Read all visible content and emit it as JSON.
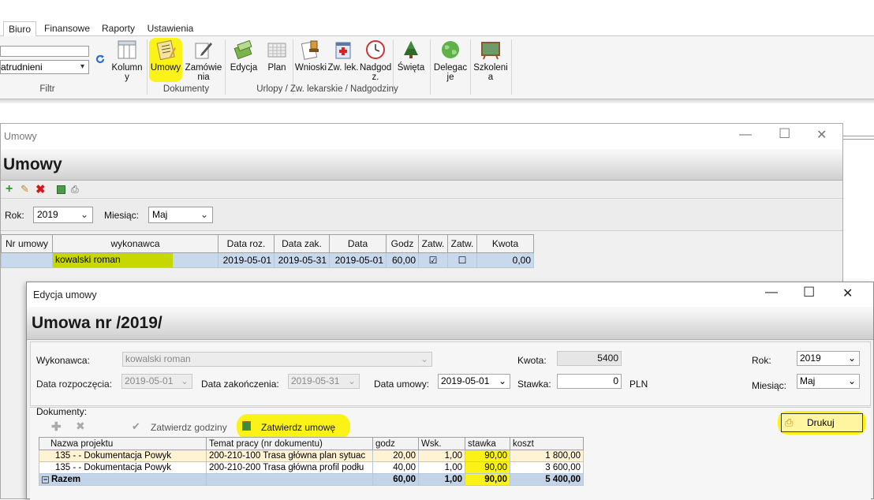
{
  "ribbon": {
    "tabs": [
      "Biuro",
      "Finansowe",
      "Raporty",
      "Ustawienia"
    ],
    "filter_combo_value": "atrudnieni",
    "buttons": {
      "kolumny": "Kolumn\ny",
      "umowy": "Umowy",
      "zamowienia": "Zamówie\nnia",
      "edycja": "Edycja",
      "plan": "Plan",
      "wnioski": "Wnioski",
      "zw_lek": "Zw. lek.",
      "nadgodziny": "Nadgod\nz.",
      "swieta": "Święta",
      "delegacje": "Delegac\nje",
      "szkolenia": "Szkoleni\na"
    },
    "groups": {
      "filtr": "Filtr",
      "dokumenty": "Dokumenty",
      "urlopy": "Urlopy / Zw. lekarskie / Nadgodziny"
    }
  },
  "umowy_window": {
    "title": "Umowy",
    "header": "Umowy",
    "rok_label": "Rok:",
    "rok_value": "2019",
    "miesiac_label": "Miesiąc:",
    "miesiac_value": "Maj",
    "columns": [
      "Nr umowy",
      "wykonawca",
      "Data roz.",
      "Data zak.",
      "Data",
      "Godz",
      "Zatw.",
      "Zatw.",
      "Kwota"
    ],
    "row": {
      "nr": "",
      "wykonawca": "kowalski roman",
      "data_roz": "2019-05-01",
      "data_zak": "2019-05-31",
      "data": "2019-05-01",
      "godz": "60,00",
      "zatw1": "☑",
      "zatw2": "☐",
      "kwota": "0,00"
    }
  },
  "edycja_window": {
    "title": "Edycja umowy",
    "header": "Umowa nr /2019/",
    "wykonawca_label": "Wykonawca:",
    "wykonawca_value": "kowalski roman",
    "kwota_label": "Kwota:",
    "kwota_value": "5400",
    "rok_label": "Rok:",
    "rok_value": "2019",
    "data_rozp_label": "Data rozpoczęcia:",
    "data_rozp_value": "2019-05-01",
    "data_zak_label": "Data zakończenia:",
    "data_zak_value": "2019-05-31",
    "data_umowy_label": "Data umowy:",
    "data_umowy_value": "2019-05-01",
    "stawka_label": "Stawka:",
    "stawka_value": "0",
    "currency": "PLN",
    "miesiac_label": "Miesiąc:",
    "miesiac_value": "Maj",
    "dokumenty_label": "Dokumenty:",
    "zatwierdz_godziny": "Zatwierdz godziny",
    "zatwierdz_umowe": "Zatwierdz umowę",
    "drukuj": "Drukuj",
    "columns": [
      "Nazwa projektu",
      "Temat pracy (nr dokumentu)",
      "godz",
      "Wsk.",
      "stawka",
      "koszt"
    ],
    "rows": [
      {
        "projekt": "135 -           - Dokumentacja Powyk",
        "temat": "200-210-100 Trasa główna plan sytuac",
        "godz": "20,00",
        "wsk": "1,00",
        "stawka": "90,00",
        "koszt": "1 800,00"
      },
      {
        "projekt": "135 -           - Dokumentacja Powyk",
        "temat": "200-210-200 Trasa główna profil podłu",
        "godz": "40,00",
        "wsk": "1,00",
        "stawka": "90,00",
        "koszt": "3 600,00"
      }
    ],
    "total": {
      "label": "Razem",
      "godz": "60,00",
      "wsk": "1,00",
      "stawka": "90,00",
      "koszt": "5 400,00"
    }
  }
}
